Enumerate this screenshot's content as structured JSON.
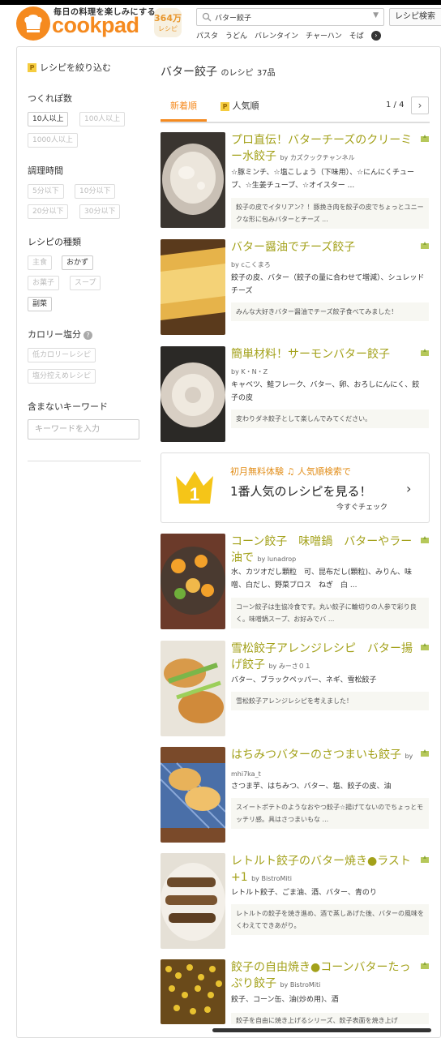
{
  "header": {
    "tagline": "毎日の料理を楽しみにする",
    "brand": "cookpad",
    "badge_number": "364万",
    "badge_label": "レシピ",
    "search_value": "バター餃子",
    "search_button": "レシピ検索",
    "suggestions": [
      "パスタ",
      "うどん",
      "バレンタイン",
      "チャーハン",
      "そば"
    ],
    "suggest_go": "›"
  },
  "sidebar": {
    "filter_title": "レシピを絞り込む",
    "tsukurepo": {
      "label": "つくれぽ数",
      "chips": [
        "10人以上",
        "100人以上",
        "1000人以上"
      ]
    },
    "cooktime": {
      "label": "調理時間",
      "chips": [
        "5分以下",
        "10分以下",
        "20分以下",
        "30分以下"
      ]
    },
    "kind": {
      "label": "レシピの種類",
      "chips": [
        "主食",
        "おかず",
        "お菓子",
        "スープ",
        "副菜"
      ]
    },
    "calorie": {
      "label": "カロリー塩分",
      "help": "?",
      "chips": [
        "低カロリーレシピ",
        "塩分控えめレシピ"
      ]
    },
    "exclude": {
      "label": "含まないキーワード",
      "placeholder": "キーワードを入力"
    }
  },
  "results": {
    "title": "バター餃子",
    "title_suffix": "のレシピ",
    "count": "37品",
    "tab_new": "新着順",
    "tab_popular": "人気順",
    "pager": "1 / 4",
    "pager_next": "›"
  },
  "recipes": [
    {
      "title": "プロ直伝！バターチーズのクリーミー水餃子",
      "author": "カズクックチャンネル",
      "ingredients": "☆豚ミンチ、☆塩こしょう（下味用）、☆にんにくチューブ、☆生姜チューブ、☆オイスター ...",
      "description": "餃子の皮でイタリアン？！豚挽き肉を餃子の皮でちょっとユニークな形に包みバターとチーズ ..."
    },
    {
      "title": "バター醤油でチーズ餃子",
      "author": "cこくまろ",
      "ingredients": "餃子の皮、バター（餃子の量に合わせて増減）、シュレッドチーズ",
      "description": "みんな大好きバター醤油でチーズ餃子食べてみました！"
    },
    {
      "title": "簡単材料！サーモンバター餃子",
      "author": "K・N・Z",
      "ingredients": "キャベツ、鮭フレーク、バター、卵、おろしにんにく、餃子の皮",
      "description": "変わりダネ餃子として楽しんでみてください。"
    },
    {
      "title": "コーン餃子　味噌鍋　バターやラー油で",
      "author": "lunadrop",
      "ingredients": "水、カツオだし顆粒　可、昆布だし(顆粒)、みりん、味噌、白だし、野菜ブロス　ねぎ　白 ...",
      "description": "コーン餃子は生協冷食です。丸い餃子に輪切りの人参で彩り良く。味噌鍋スープ、お好みでバ ..."
    },
    {
      "title": "雪松餃子アレンジレシピ　バター揚げ餃子",
      "author": "みーさ０１",
      "ingredients": "バター、ブラックペッパー、ネギ、雪松餃子",
      "description": "雪松餃子アレンジレシピを考えました！"
    },
    {
      "title": "はちみつバターのさつまいも餃子",
      "author": "mhi7ka_t",
      "ingredients": "さつま芋、はちみつ、バター、塩、餃子の皮、油",
      "description": "スイートポテトのようなおやつ餃子☆揚げてないのでちょっとモッチリ感。具はさつまいもな ..."
    },
    {
      "title": "レトルト餃子のバター焼き●ラスト+1",
      "author": "BistroMiti",
      "ingredients": "レトルト餃子、ごま油、酒、バター、青のり",
      "description": "レトルトの餃子を焼き進め、酒で蒸しあげた後、バターの風味をくわえてできあがり。"
    },
    {
      "title": "餃子の自由焼き●コーンバターたっぷり餃子",
      "author": "BistroMiti",
      "ingredients": "餃子、コーン缶、油(炒め用)、酒",
      "description": "餃子を自由に焼き上げるシリーズ、餃子表面を焼き上げ"
    }
  ],
  "promo": {
    "badge": "1",
    "line1": "初月無料体験 ♫ 人気順検索で",
    "line2": "1番人気のレシピを見る！",
    "line3": "今すぐチェック",
    "chevron": "›"
  },
  "author_prefix": "by",
  "colors": {
    "brand": "#f58a1f",
    "title": "#a3a11a",
    "gold": "#f5c518"
  }
}
